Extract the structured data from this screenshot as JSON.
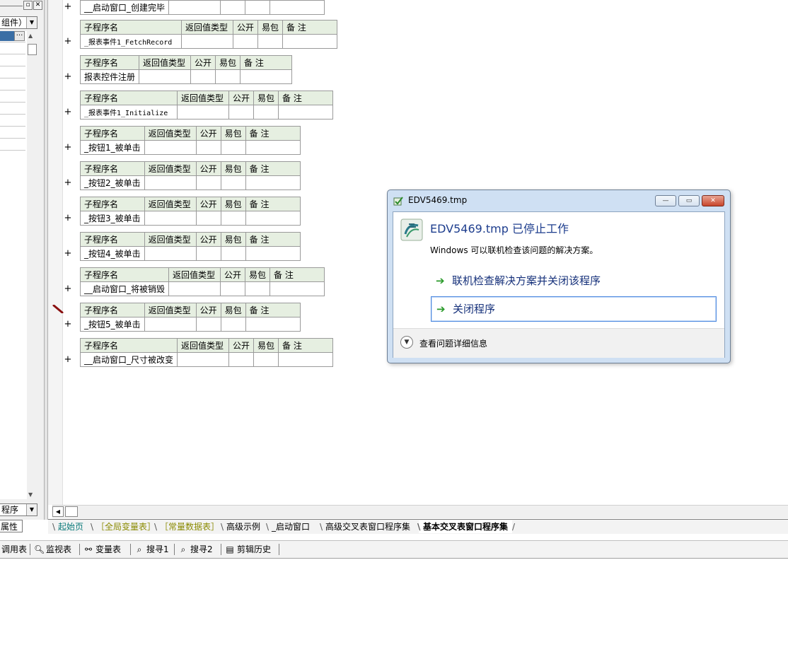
{
  "left_panel": {
    "combo_text": "组件）",
    "bottom_combo_text": "程序",
    "props_tab": "属性"
  },
  "editor": {
    "table_headers": [
      "子程序名",
      "返回值类型",
      "公开",
      "易包",
      "备 注"
    ],
    "partial_sub_name": "__启动窗口_创建完毕",
    "subroutines": [
      {
        "name": "_报表事件1_FetchRecord"
      },
      {
        "name": "报表控件注册"
      },
      {
        "name": "_报表事件1_Initialize"
      },
      {
        "name": "_按钮1_被单击"
      },
      {
        "name": "_按钮2_被单击"
      },
      {
        "name": "_按钮3_被单击"
      },
      {
        "name": "_按钮4_被单击"
      },
      {
        "name": "__启动窗口_将被销毁"
      },
      {
        "name": "_按钮5_被单击"
      },
      {
        "name": "__启动窗口_尺寸被改变"
      }
    ],
    "plus_symbol": "+"
  },
  "tabs": [
    {
      "label": "起始页",
      "color": "#0a7a7a"
    },
    {
      "label": "［全局变量表］",
      "color": "#8a8a00"
    },
    {
      "label": "［常量数据表］",
      "color": "#8a8a00"
    },
    {
      "label": "高级示例",
      "color": "#000000"
    },
    {
      "label": "_启动窗口",
      "color": "#000000"
    },
    {
      "label": "高级交叉表窗口程序集",
      "color": "#000000"
    },
    {
      "label": "基本交叉表窗口程序集",
      "color": "#000000",
      "active": true
    }
  ],
  "bottom_toolbar": [
    {
      "label": "调用表",
      "icon": ""
    },
    {
      "label": "监视表",
      "icon": "magnifier-icon"
    },
    {
      "label": "变量表",
      "icon": "variables-icon"
    },
    {
      "label": "搜寻1",
      "icon": "search-doc-icon"
    },
    {
      "label": "搜寻2",
      "icon": "search-doc-icon"
    },
    {
      "label": "剪辑历史",
      "icon": "clipboard-icon"
    }
  ],
  "dialog": {
    "title": "EDV5469.tmp",
    "headline": "EDV5469.tmp 已停止工作",
    "subtext": "Windows 可以联机检查该问题的解决方案。",
    "option_online": "联机检查解决方案并关闭该程序",
    "option_close": "关闭程序",
    "details": "查看问题详细信息"
  }
}
